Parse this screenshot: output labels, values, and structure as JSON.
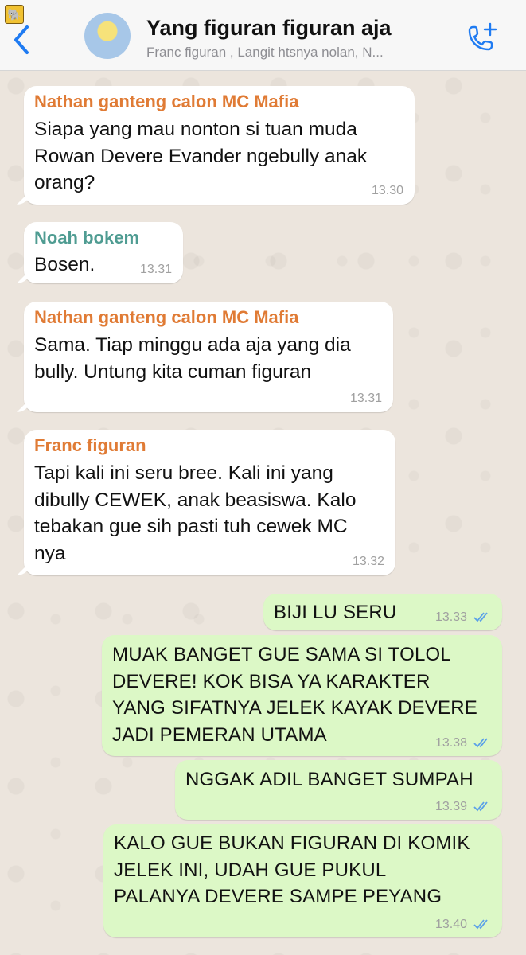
{
  "header": {
    "title": "Yang figuran figuran aja",
    "subtitle": "Franc figuran , Langit htsnya nolan, N..."
  },
  "messages": [
    {
      "sender": "Nathan ganteng calon MC Mafia",
      "sender_color": "#e07b35",
      "lines": [
        "Siapa yang mau nonton si tuan muda",
        "Rowan Devere  Evander ngebully anak",
        "orang?"
      ],
      "time": "13.30"
    },
    {
      "sender": "Noah bokem",
      "sender_color": "#4f9c92",
      "lines": [
        "Bosen."
      ],
      "time": "13.31"
    },
    {
      "sender": "Nathan ganteng calon MC Mafia",
      "sender_color": "#e07b35",
      "lines": [
        "Sama. Tiap minggu ada aja yang dia",
        "bully. Untung kita cuman figuran"
      ],
      "time": "13.31"
    },
    {
      "sender": "Franc figuran",
      "sender_color": "#e07b35",
      "lines": [
        "Tapi kali ini seru bree. Kali ini yang",
        "dibully CEWEK, anak beasiswa. Kalo",
        "tebakan gue sih pasti tuh cewek MC",
        "nya"
      ],
      "time": "13.32"
    },
    {
      "lines": [
        "BIJI LU SERU"
      ],
      "time": "13.33"
    },
    {
      "lines": [
        "MUAK BANGET GUE SAMA SI TOLOL",
        "DEVERE! KOK BISA YA KARAKTER",
        "YANG SIFATNYA JELEK KAYAK DEVERE",
        "JADI PEMERAN UTAMA"
      ],
      "time": "13.38"
    },
    {
      "lines": [
        "NGGAK ADIL BANGET SUMPAH"
      ],
      "time": "13.39"
    },
    {
      "lines": [
        "KALO GUE BUKAN FIGURAN DI KOMIK",
        "JELEK INI, UDAH GUE PUKUL",
        "PALANYA DEVERE SAMPE PEYANG"
      ],
      "time": "13.40"
    }
  ],
  "icons": {
    "back": "chevron-left-icon",
    "call": "phone-add-icon",
    "read_receipt": "double-check-icon",
    "corner": "elephant-icon"
  },
  "colors": {
    "accent": "#1f7bf2",
    "incoming_bubble": "#ffffff",
    "outgoing_bubble": "#dcf8c6",
    "read_ticks": "#5aa0e8",
    "chat_background": "#ece5dd"
  }
}
